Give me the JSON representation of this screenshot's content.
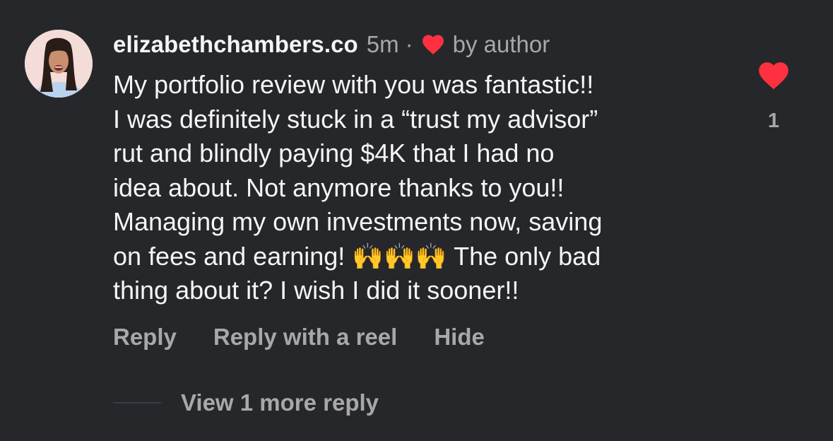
{
  "comment": {
    "avatar_icon": "profile-photo",
    "username": "elizabethchambers.co",
    "time": "5m",
    "separator": "·",
    "author_like_icon": "heart-icon",
    "author_like_label": "by author",
    "text_lines": [
      "My portfolio review with you was fantastic!!",
      "I was definitely stuck in a “trust my advisor”",
      "rut and blindly paying $4K that I had no",
      "idea about. Not anymore thanks to you!!",
      "Managing my own investments now, saving",
      "on fees and earning! 🙌🙌🙌 The only bad",
      "thing about it? I wish I did it sooner!!"
    ],
    "like": {
      "icon": "heart-filled-icon",
      "count": "1",
      "color": "#ff3040"
    },
    "actions": {
      "reply": "Reply",
      "reply_with_reel": "Reply with a reel",
      "hide": "Hide"
    },
    "view_more_replies": "View 1 more reply"
  },
  "colors": {
    "background": "#25272b",
    "primary_text": "#f5f5f5",
    "secondary_text": "#a8a8a8",
    "heart_red": "#ff3040"
  }
}
